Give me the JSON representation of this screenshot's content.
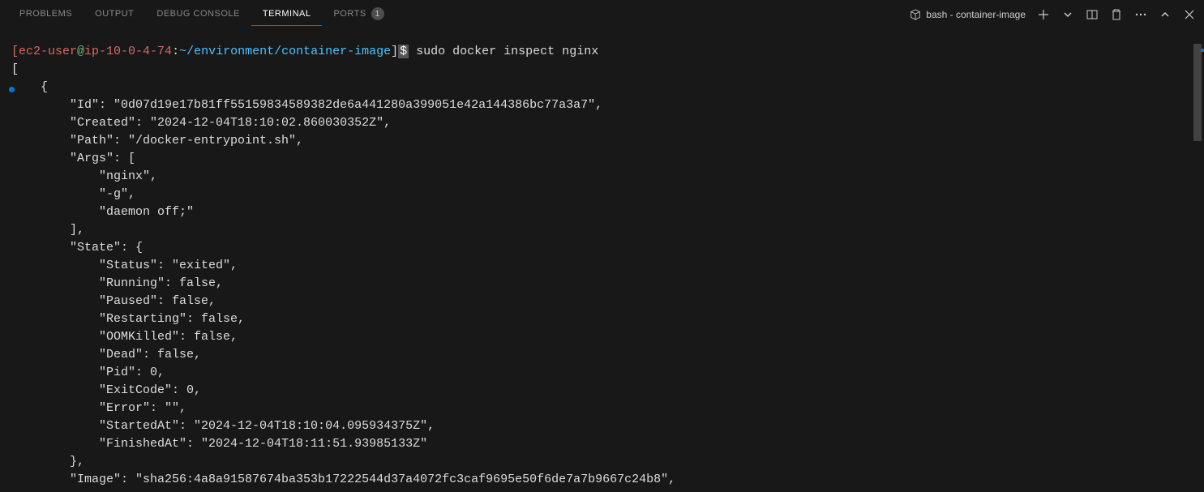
{
  "tabs": {
    "problems": "PROBLEMS",
    "output": "OUTPUT",
    "debug_console": "DEBUG CONSOLE",
    "terminal": "TERMINAL",
    "ports": "PORTS",
    "ports_badge": "1"
  },
  "terminal_selector": {
    "label": "bash - container-image"
  },
  "prompt": {
    "user": "[ec2-user",
    "at": "@",
    "host": "ip-10-0-4-74",
    "colon": ":",
    "path": "~/environment/container-image",
    "end": "]",
    "dollar": "$"
  },
  "command": " sudo docker inspect nginx",
  "output": [
    "[",
    "    {",
    "        \"Id\": \"0d07d19e17b81ff55159834589382de6a441280a399051e42a144386bc77a3a7\",",
    "        \"Created\": \"2024-12-04T18:10:02.860030352Z\",",
    "        \"Path\": \"/docker-entrypoint.sh\",",
    "        \"Args\": [",
    "            \"nginx\",",
    "            \"-g\",",
    "            \"daemon off;\"",
    "        ],",
    "        \"State\": {",
    "            \"Status\": \"exited\",",
    "            \"Running\": false,",
    "            \"Paused\": false,",
    "            \"Restarting\": false,",
    "            \"OOMKilled\": false,",
    "            \"Dead\": false,",
    "            \"Pid\": 0,",
    "            \"ExitCode\": 0,",
    "            \"Error\": \"\",",
    "            \"StartedAt\": \"2024-12-04T18:10:04.095934375Z\",",
    "            \"FinishedAt\": \"2024-12-04T18:11:51.93985133Z\"",
    "        },",
    "        \"Image\": \"sha256:4a8a91587674ba353b17222544d37a4072fc3caf9695e50f6de7a7b9667c24b8\","
  ]
}
